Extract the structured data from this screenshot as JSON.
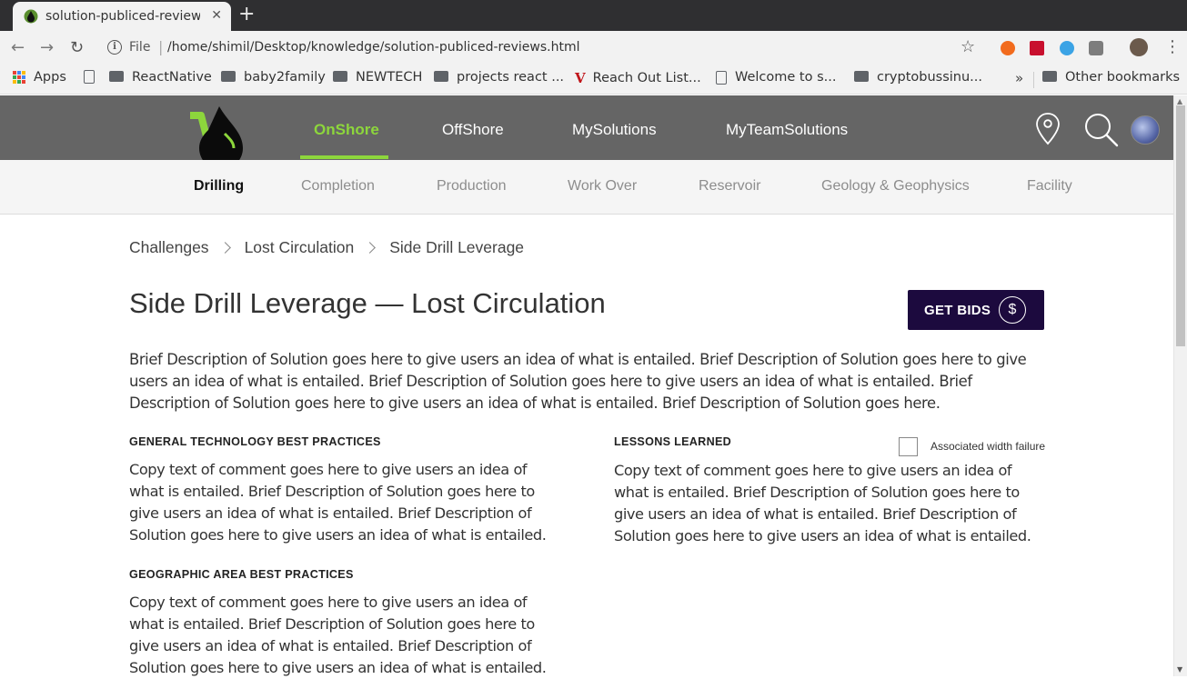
{
  "browser": {
    "tab_title": "solution-publiced-reviews.html",
    "url_scheme": "File",
    "url": "/home/shimil/Desktop/knowledge/solution-publiced-reviews.html"
  },
  "bookmarks": {
    "apps": "Apps",
    "items": [
      "ReactNative",
      "baby2family",
      "NEWTECH",
      "projects react ...",
      "Reach Out List...",
      "Welcome to s...",
      "cryptobussinu..."
    ],
    "overflow": "»",
    "other": "Other bookmarks"
  },
  "site": {
    "main_nav": [
      "OnShore",
      "OffShore",
      "MySolutions",
      "MyTeamSolutions"
    ],
    "sub_nav": [
      "Drilling",
      "Completion",
      "Production",
      "Work Over",
      "Reservoir",
      "Geology & Geophysics",
      "Facility"
    ]
  },
  "breadcrumb": [
    "Challenges",
    "Lost Circulation",
    "Side Drill Leverage"
  ],
  "page": {
    "title": "Side Drill Leverage — Lost Circulation",
    "get_bids": "GET BIDS",
    "dollar": "$",
    "intro": "Brief Description of Solution goes here to give users an idea of what is entailed. Brief Description of Solution goes here to give users an idea of what is entailed. Brief Description of Solution goes here to give users an idea of what is entailed. Brief Description of Solution goes here to give users an idea of what is entailed. Brief Description of Solution goes here."
  },
  "sections": {
    "general": {
      "heading": "GENERAL TECHNOLOGY BEST PRACTICES",
      "body": "Copy text of comment goes here to give users an idea of what is entailed. Brief Description of Solution goes here to give users an idea of what is entailed. Brief Description of Solution goes here to give users an idea of what is entailed."
    },
    "lessons": {
      "heading": "LESSONS LEARNED",
      "checkbox_label": "Associated width failure",
      "checked": false,
      "body": "Copy text of comment goes here to give users an idea of what is entailed. Brief Description of Solution goes here to give users an idea of what is entailed. Brief Description of Solution goes here to give users an idea of what is entailed."
    },
    "geographic": {
      "heading": "GEOGRAPHIC AREA BEST PRACTICES",
      "body": "Copy text of comment goes here to give users an idea of what is entailed. Brief Description of Solution goes here to give users an idea of what is entailed. Brief Description of Solution goes here to give users an idea of what is entailed."
    }
  },
  "colors": {
    "header_bg": "#656565",
    "accent_green": "#8dd63c",
    "button_bg": "#1c0a3e"
  },
  "icons": [
    "location-pin-icon",
    "search-icon",
    "dollar-icon",
    "chevron-right-icon",
    "star-icon",
    "folder-icon"
  ]
}
